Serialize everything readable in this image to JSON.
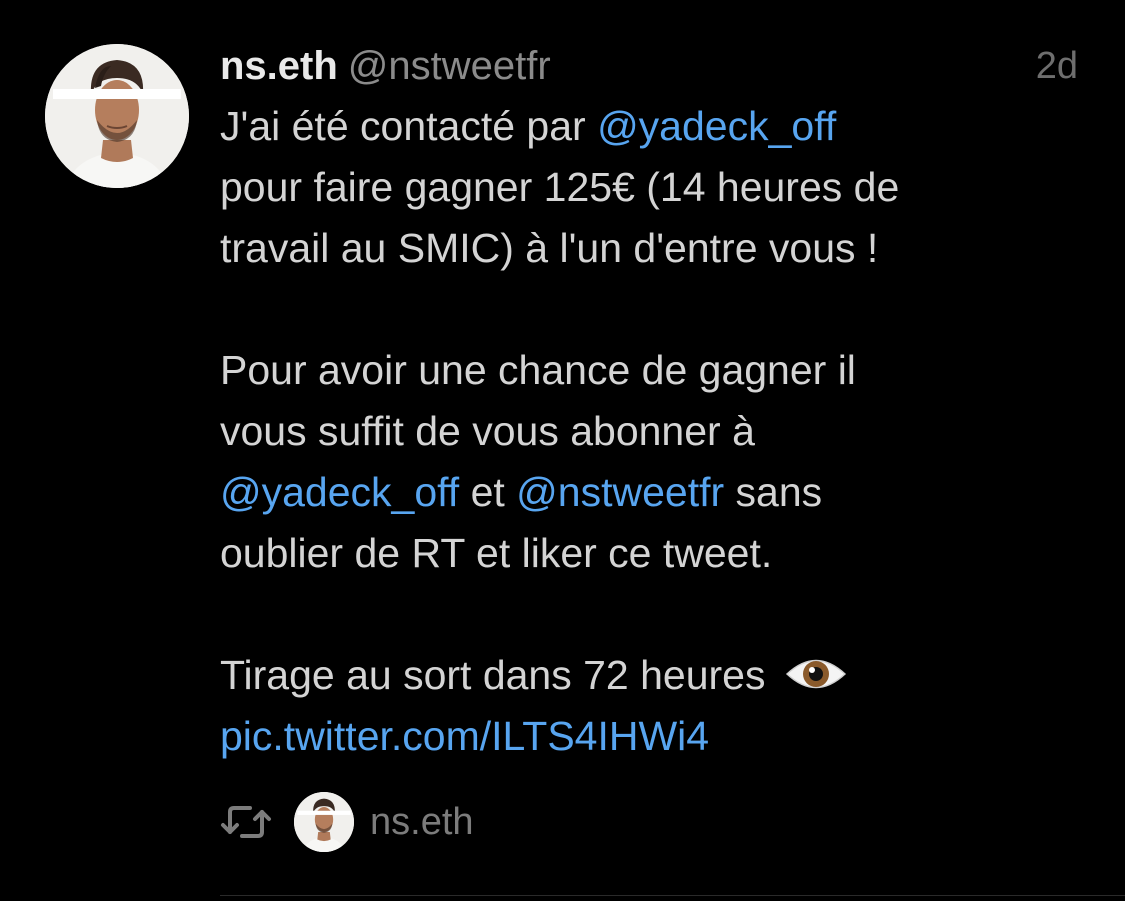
{
  "tweet": {
    "author": {
      "display_name": "ns.eth",
      "handle": "@nstweetfr",
      "avatar_icon": "profile-photo"
    },
    "timestamp": "2d",
    "text": {
      "l1_pre": "J'ai été contacté par ",
      "l1_mention": "@yadeck_off",
      "l2": "pour faire gagner 125€ (14 heures de",
      "l3": "travail au SMIC) à l'un d'entre vous !",
      "l4": "Pour avoir une chance de gagner il",
      "l5": "vous suffit de vous abonner à",
      "l6_mention1": "@yadeck_off",
      "l6_mid": " et ",
      "l6_mention2": "@nstweetfr",
      "l6_post": " sans",
      "l7": "oublier de RT et liker ce tweet.",
      "l8": "Tirage au sort dans 72 heures ",
      "l8_emoji": "eye-emoji",
      "l9_link": "pic.twitter.com/ILTS4IHWi4"
    },
    "footer": {
      "retweet_icon": "retweet-icon",
      "retweeter_name": "ns.eth"
    }
  },
  "colors": {
    "background": "#000000",
    "text": "#d4d4d4",
    "link": "#58a5f0",
    "muted": "#8b8b8b"
  }
}
